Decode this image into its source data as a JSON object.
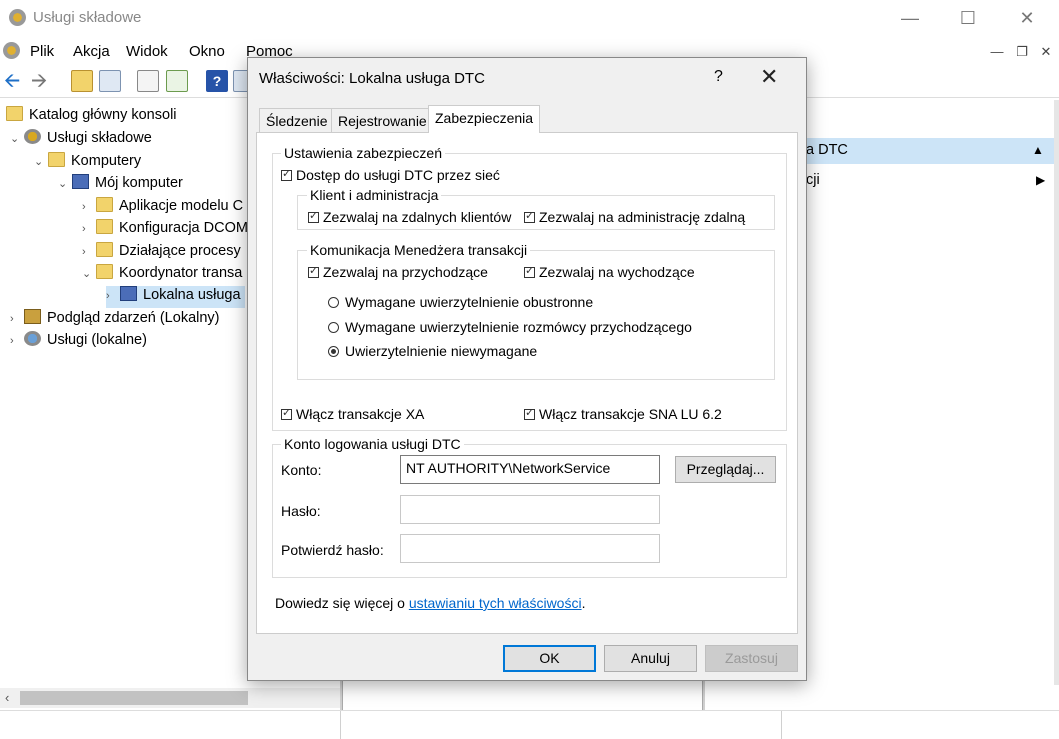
{
  "app": {
    "title": "Usługi składowe",
    "menu": [
      "Plik",
      "Akcja",
      "Widok",
      "Okno",
      "Pomoc"
    ]
  },
  "tree": {
    "items": [
      {
        "label": "Katalog główny konsoli",
        "depth": 0,
        "arrow": ""
      },
      {
        "label": "Usługi składowe",
        "depth": 1,
        "arrow": "⌄"
      },
      {
        "label": "Komputery",
        "depth": 2,
        "arrow": "⌄"
      },
      {
        "label": "Mój komputer",
        "depth": 3,
        "arrow": "⌄"
      },
      {
        "label": "Aplikacje modelu C",
        "depth": 4,
        "arrow": "›"
      },
      {
        "label": "Konfiguracja DCOM",
        "depth": 4,
        "arrow": "›"
      },
      {
        "label": "Działające procesy",
        "depth": 4,
        "arrow": "›"
      },
      {
        "label": "Koordynator transa",
        "depth": 4,
        "arrow": "⌄"
      },
      {
        "label": "Lokalna usługa",
        "depth": 5,
        "arrow": "›"
      },
      {
        "label": "Podgląd zdarzeń (Lokalny)",
        "depth": 1,
        "arrow": "›"
      },
      {
        "label": "Usługi (lokalne)",
        "depth": 1,
        "arrow": "›"
      }
    ]
  },
  "actions": {
    "header": "a DTC",
    "item": "cji"
  },
  "dialog": {
    "title": "Właściwości: Lokalna usługa DTC",
    "help": "?",
    "close": "✕",
    "tabs": [
      "Śledzenie",
      "Rejestrowanie",
      "Zabezpieczenia"
    ],
    "security": {
      "group_title": "Ustawienia zabezpieczeń",
      "network_access": "Dostęp do usługi DTC przez sieć",
      "client_admin": {
        "title": "Klient i administracja",
        "allow_remote_clients": "Zezwalaj na zdalnych klientów",
        "allow_remote_admin": "Zezwalaj na administrację zdalną"
      },
      "tm_comm": {
        "title": "Komunikacja Menedżera transakcji",
        "allow_inbound": "Zezwalaj na przychodzące",
        "allow_outbound": "Zezwalaj na wychodzące",
        "mutual_auth": "Wymagane uwierzytelnienie obustronne",
        "incoming_auth": "Wymagane uwierzytelnienie rozmówcy przychodzącego",
        "no_auth": "Uwierzytelnienie niewymagane"
      },
      "enable_xa": "Włącz transakcje XA",
      "enable_sna": "Włącz transakcje SNA LU 6.2"
    },
    "logon": {
      "group_title": "Konto logowania usługi DTC",
      "account_label": "Konto:",
      "account_value": "NT AUTHORITY\\NetworkService",
      "browse": "Przeglądaj...",
      "password_label": "Hasło:",
      "confirm_label": "Potwierdź hasło:"
    },
    "learn_more_prefix": "Dowiedz się więcej o ",
    "learn_more_link": "ustawianiu tych właściwości",
    "learn_more_suffix": ".",
    "buttons": {
      "ok": "OK",
      "cancel": "Anuluj",
      "apply": "Zastosuj"
    }
  }
}
